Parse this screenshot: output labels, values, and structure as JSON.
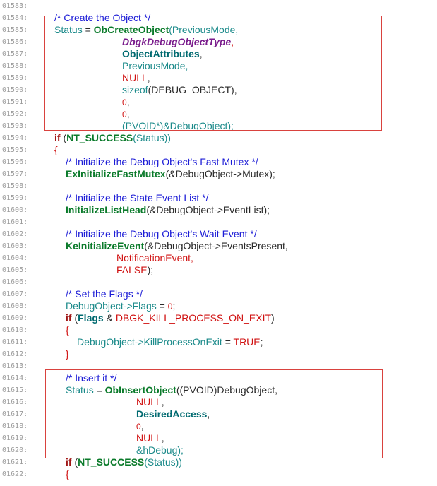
{
  "editor": {
    "lines": [
      {
        "n": "01583:",
        "s": []
      },
      {
        "n": "01584:",
        "s": [
          [
            "c",
            "/* Create the Object */"
          ]
        ]
      },
      {
        "n": "01585:",
        "s": [
          [
            "i",
            "Status"
          ],
          [
            "o",
            " = "
          ],
          [
            "f",
            "ObCreateObject"
          ],
          [
            "i",
            "(PreviousMode,"
          ]
        ]
      },
      {
        "n": "01586:",
        "s": [
          [
            "t",
            "DbgkDebugObjectType"
          ],
          [
            "m",
            ","
          ]
        ]
      },
      {
        "n": "01587:",
        "s": [
          [
            "p",
            "ObjectAttributes"
          ],
          [
            "o",
            ","
          ]
        ]
      },
      {
        "n": "01588:",
        "s": [
          [
            "i",
            "PreviousMode,"
          ]
        ]
      },
      {
        "n": "01589:",
        "s": [
          [
            "m",
            "NULL"
          ],
          [
            "o",
            ","
          ]
        ]
      },
      {
        "n": "01590:",
        "s": [
          [
            "i",
            "sizeof"
          ],
          [
            "o",
            "(DEBUG_OBJECT),"
          ]
        ]
      },
      {
        "n": "01591:",
        "s": [
          [
            "n",
            "0"
          ],
          [
            "o",
            ","
          ]
        ]
      },
      {
        "n": "01592:",
        "s": [
          [
            "n",
            "0"
          ],
          [
            "o",
            ","
          ]
        ]
      },
      {
        "n": "01593:",
        "s": [
          [
            "i",
            "(PVOID*)&DebugObject);"
          ]
        ]
      },
      {
        "n": "01594:",
        "s": [
          [
            "kw",
            "if"
          ],
          [
            "o",
            " ("
          ],
          [
            "f",
            "NT_SUCCESS"
          ],
          [
            "i",
            "(Status))"
          ]
        ]
      },
      {
        "n": "01595:",
        "s": [
          [
            "m",
            "{"
          ]
        ]
      },
      {
        "n": "01596:",
        "s": [
          [
            "c",
            "/* Initialize the Debug Object's Fast Mutex */"
          ]
        ]
      },
      {
        "n": "01597:",
        "s": [
          [
            "f",
            "ExInitializeFastMutex"
          ],
          [
            "o",
            "(&DebugObject->Mutex);"
          ]
        ]
      },
      {
        "n": "01598:",
        "s": []
      },
      {
        "n": "01599:",
        "s": [
          [
            "c",
            "/* Initialize the State Event List */"
          ]
        ]
      },
      {
        "n": "01600:",
        "s": [
          [
            "f",
            "InitializeListHead"
          ],
          [
            "o",
            "(&DebugObject->EventList);"
          ]
        ]
      },
      {
        "n": "01601:",
        "s": []
      },
      {
        "n": "01602:",
        "s": [
          [
            "c",
            "/* Initialize the Debug Object's Wait Event */"
          ]
        ]
      },
      {
        "n": "01603:",
        "s": [
          [
            "f",
            "KeInitializeEvent"
          ],
          [
            "o",
            "(&DebugObject->EventsPresent,"
          ]
        ]
      },
      {
        "n": "01604:",
        "s": [
          [
            "m",
            "NotificationEvent,"
          ]
        ]
      },
      {
        "n": "01605:",
        "s": [
          [
            "m",
            "FALSE"
          ],
          [
            "o",
            ");"
          ]
        ]
      },
      {
        "n": "01606:",
        "s": []
      },
      {
        "n": "01607:",
        "s": [
          [
            "c",
            "/* Set the Flags */"
          ]
        ]
      },
      {
        "n": "01608:",
        "s": [
          [
            "i",
            "DebugObject->Flags"
          ],
          [
            "o",
            " = "
          ],
          [
            "n",
            "0"
          ],
          [
            "o",
            ";"
          ]
        ]
      },
      {
        "n": "01609:",
        "s": [
          [
            "kw",
            "if"
          ],
          [
            "o",
            " ("
          ],
          [
            "p",
            "Flags"
          ],
          [
            "o",
            " & "
          ],
          [
            "m",
            "DBGK_KILL_PROCESS_ON_EXIT"
          ],
          [
            "o",
            ")"
          ]
        ]
      },
      {
        "n": "01610:",
        "s": [
          [
            "m",
            "{"
          ]
        ]
      },
      {
        "n": "01611:",
        "s": [
          [
            "i",
            "DebugObject->KillProcessOnExit"
          ],
          [
            "o",
            " = "
          ],
          [
            "m",
            "TRUE"
          ],
          [
            "o",
            ";"
          ]
        ]
      },
      {
        "n": "01612:",
        "s": [
          [
            "m",
            "}"
          ]
        ]
      },
      {
        "n": "01613:",
        "s": []
      },
      {
        "n": "01614:",
        "s": [
          [
            "c",
            "/* Insert it */"
          ]
        ]
      },
      {
        "n": "01615:",
        "s": [
          [
            "i",
            "Status"
          ],
          [
            "o",
            " = "
          ],
          [
            "f",
            "ObInsertObject"
          ],
          [
            "o",
            "((PVOID)DebugObject,"
          ]
        ]
      },
      {
        "n": "01616:",
        "s": [
          [
            "m",
            "NULL"
          ],
          [
            "o",
            ","
          ]
        ]
      },
      {
        "n": "01617:",
        "s": [
          [
            "p",
            "DesiredAccess"
          ],
          [
            "o",
            ","
          ]
        ]
      },
      {
        "n": "01618:",
        "s": [
          [
            "n",
            "0"
          ],
          [
            "o",
            ","
          ]
        ]
      },
      {
        "n": "01619:",
        "s": [
          [
            "m",
            "NULL"
          ],
          [
            "o",
            ","
          ]
        ]
      },
      {
        "n": "01620:",
        "s": [
          [
            "i",
            "&hDebug);"
          ]
        ]
      },
      {
        "n": "01621:",
        "s": [
          [
            "kw",
            "if"
          ],
          [
            "o",
            " ("
          ],
          [
            "f",
            "NT_SUCCESS"
          ],
          [
            "i",
            "(Status))"
          ]
        ]
      },
      {
        "n": "01622:",
        "s": [
          [
            "m",
            "{"
          ]
        ]
      }
    ]
  },
  "colors": {
    "comment": "#1b1bd6",
    "identifier": "#1b8a8a",
    "function": "#0a7a2a",
    "keyword": "#a01616",
    "macro": "#d01010",
    "highlight_border": "#d9423e"
  }
}
